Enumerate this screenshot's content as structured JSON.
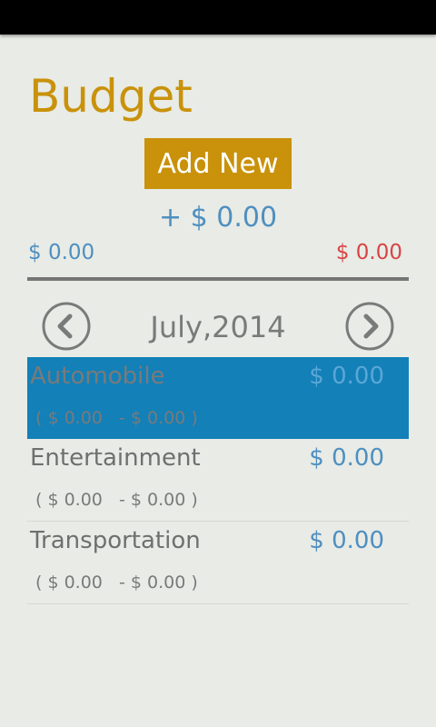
{
  "header": {
    "title": "Budget",
    "add_button_label": "Add New"
  },
  "summary": {
    "total": "+ $ 0.00",
    "income": "$ 0.00",
    "expense": "$ 0.00"
  },
  "nav": {
    "month": "July,2014",
    "prev_icon": "chevron-left-icon",
    "next_icon": "chevron-right-icon"
  },
  "categories": [
    {
      "name": "Automobile",
      "amount": "$ 0.00",
      "detail": "( $ 0.00   - $ 0.00 )",
      "selected": true
    },
    {
      "name": "Entertainment",
      "amount": "$ 0.00",
      "detail": "( $ 0.00   - $ 0.00 )",
      "selected": false
    },
    {
      "name": "Transportation",
      "amount": "$ 0.00",
      "detail": "( $ 0.00   - $ 0.00 )",
      "selected": false
    }
  ],
  "colors": {
    "accent": "#c9920a",
    "positive": "#4f8fbf",
    "negative": "#d94444",
    "selection": "#1380b8"
  }
}
